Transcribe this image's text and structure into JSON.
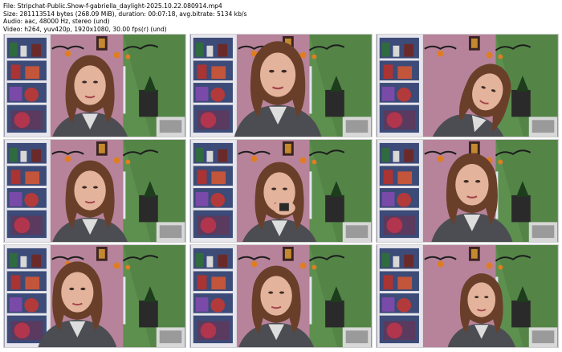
{
  "header": {
    "file_line": "File: Stripchat-Public.Show-f-gabriella_daylight-2025.10.22.080914.mp4",
    "size_line": "Size: 281113514 bytes (268.09 MiB), duration: 00:07:18, avg.bitrate: 5134 kb/s",
    "audio_line": "Audio: aac, 48000 Hz, stereo (und)",
    "video_line": "Video: h264, yuv420p, 1920x1080, 30.00 fps(r) (und)"
  },
  "thumbnails": [
    {
      "pose": "center-down"
    },
    {
      "pose": "center-up"
    },
    {
      "pose": "right-bow"
    },
    {
      "pose": "center-down"
    },
    {
      "pose": "hands-face"
    },
    {
      "pose": "center"
    },
    {
      "pose": "left"
    },
    {
      "pose": "center-down"
    },
    {
      "pose": "small-right"
    }
  ],
  "colors": {
    "wall_pink": "#b7839a",
    "wall_green": "#5d8f4e",
    "shelf_white": "#e6e6ec",
    "hair": "#6a3f2a",
    "skin": "#e3b39c",
    "hoodie": "#4b4d52",
    "pumpkin": "#e07d22"
  }
}
